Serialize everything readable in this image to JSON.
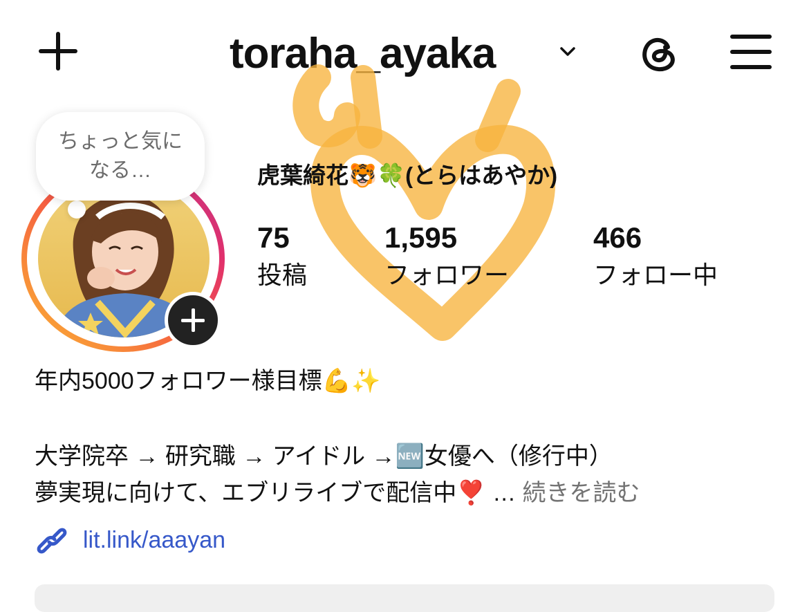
{
  "header": {
    "username": "toraha_ayaka",
    "new_post_icon": "plus-icon",
    "account_switch_icon": "chevron-down-icon",
    "threads_icon": "threads-icon",
    "menu_icon": "hamburger-menu-icon"
  },
  "profile": {
    "note": "ちょっと気になる…",
    "display_name": "虎葉綺花🐯🍀(とらはあやか)",
    "stats": [
      {
        "value": "75",
        "label": "投稿"
      },
      {
        "value": "1,595",
        "label": "フォロワー"
      },
      {
        "value": "466",
        "label": "フォロー中"
      }
    ],
    "bio_lines": [
      "年内5000フォロワー様目標💪✨",
      "大学院卒 → 研究職 → アイドル →🆕女優へ（修行中）",
      "夢実現に向けて、エブリライブで配信中❣️ …"
    ],
    "read_more": "続きを読む",
    "link": "lit.link/aaayan"
  },
  "colors": {
    "text": "#111111",
    "muted": "#737373",
    "link": "#3658c9",
    "watermark": "#f7b33d"
  }
}
